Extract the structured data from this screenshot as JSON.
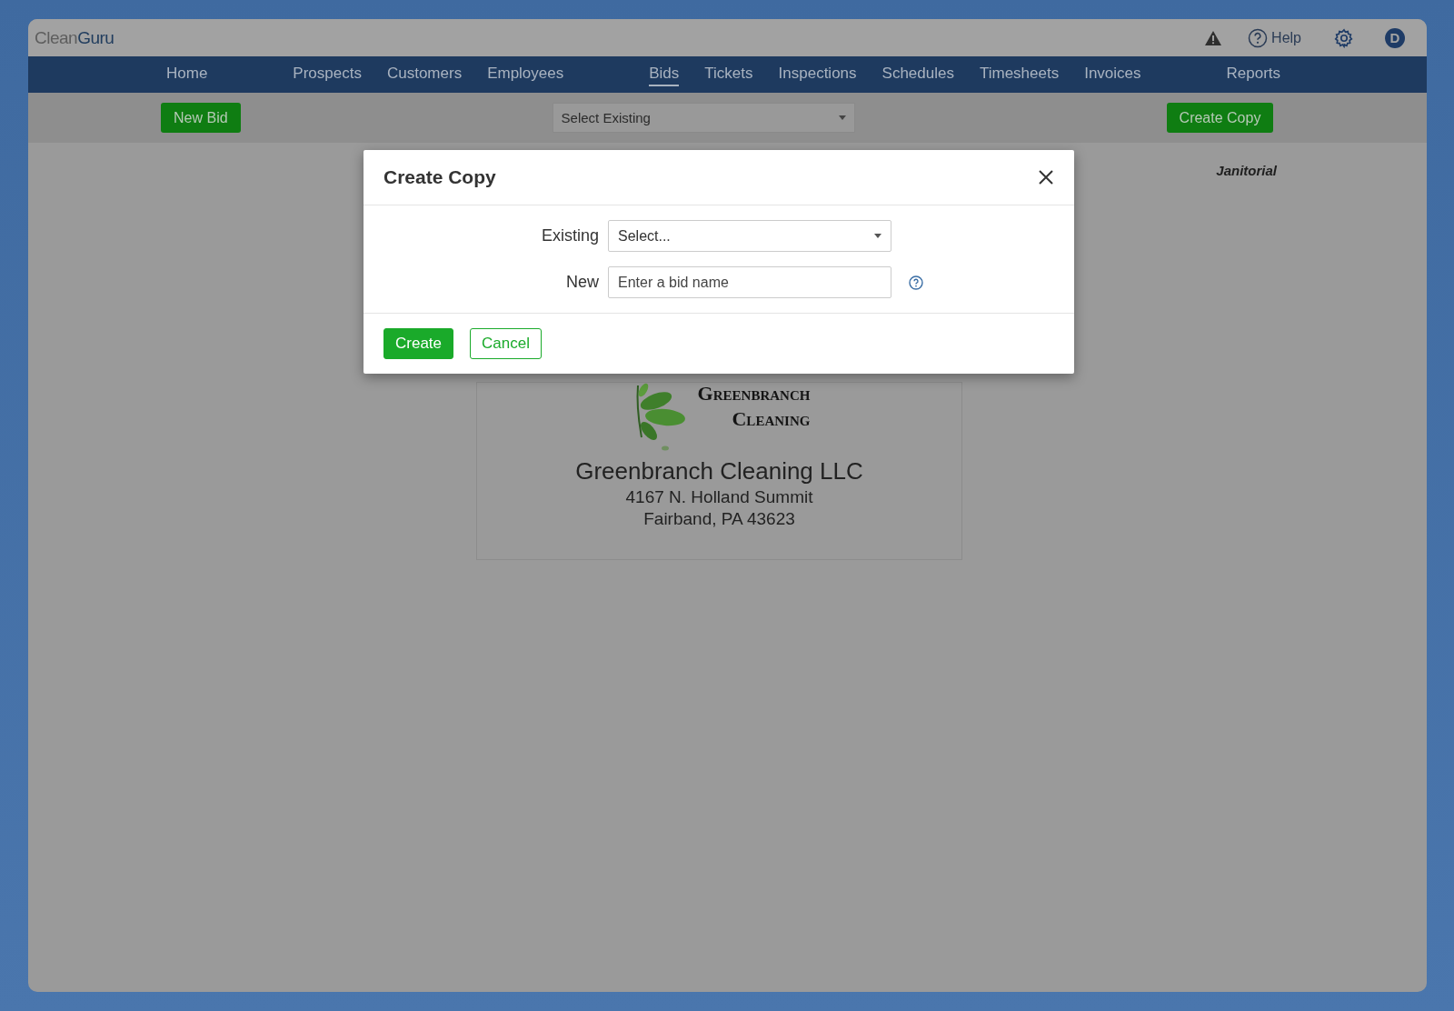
{
  "header": {
    "logo": {
      "first": "Clean",
      "second": "Guru"
    },
    "help_label": "Help",
    "avatar_initial": "D"
  },
  "nav": [
    {
      "label": "Home",
      "selected": false
    },
    {
      "label": "Prospects",
      "selected": false
    },
    {
      "label": "Customers",
      "selected": false
    },
    {
      "label": "Employees",
      "selected": false
    },
    {
      "label": "Bids",
      "selected": true
    },
    {
      "label": "Tickets",
      "selected": false
    },
    {
      "label": "Inspections",
      "selected": false
    },
    {
      "label": "Schedules",
      "selected": false
    },
    {
      "label": "Timesheets",
      "selected": false
    },
    {
      "label": "Invoices",
      "selected": false
    },
    {
      "label": "Reports",
      "selected": false
    }
  ],
  "toolbar": {
    "new_button": "New Bid",
    "select": {
      "value": "Select Existing"
    },
    "copy_button": "Create Copy"
  },
  "category": "Janitorial",
  "company_card": {
    "logo_line_1": "Greenbranch",
    "logo_line_2": "Cleaning",
    "name": "Greenbranch Cleaning LLC",
    "address_1": "4167 N. Holland Summit",
    "address_2": "Fairband, PA 43623"
  },
  "dialog": {
    "title": "Create Copy",
    "fields": [
      {
        "kind": "select",
        "label": "Existing",
        "value": "Select..."
      },
      {
        "kind": "text",
        "label": "New",
        "placeholder": "Enter a bid name"
      }
    ],
    "buttons": [
      {
        "label": "Create",
        "kind": "primary"
      },
      {
        "label": "Cancel",
        "kind": "secondary"
      }
    ]
  }
}
